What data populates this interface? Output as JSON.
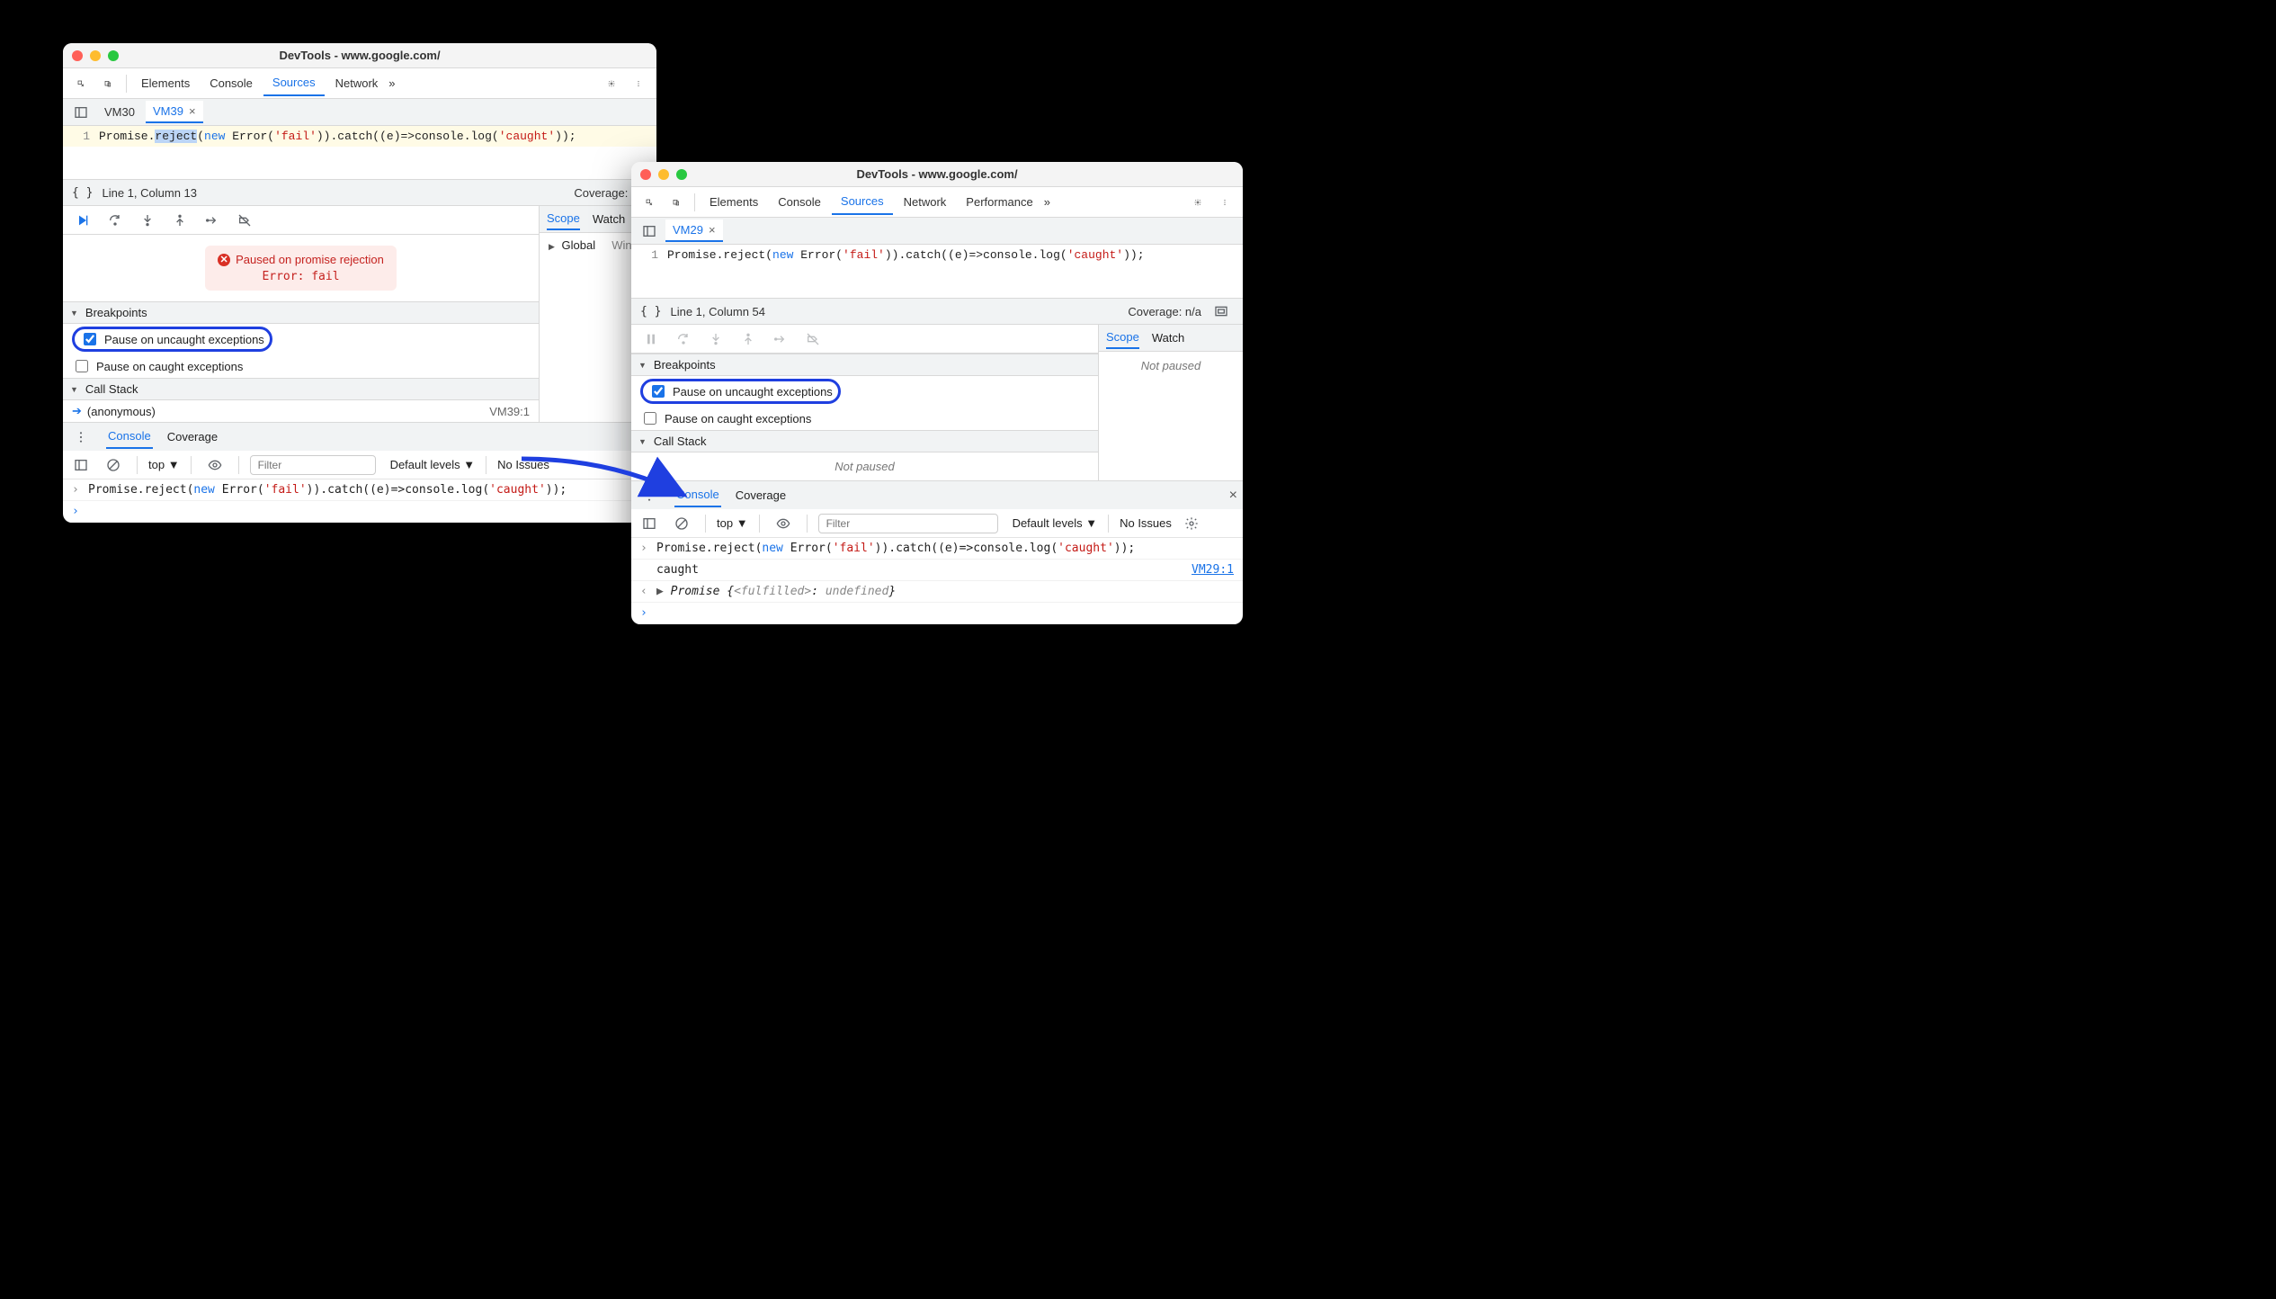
{
  "left": {
    "title": "DevTools - www.google.com/",
    "tabs": [
      "Elements",
      "Console",
      "Sources",
      "Network"
    ],
    "active_tab": "Sources",
    "overflow": "»",
    "files": {
      "inactive": "VM30",
      "active": "VM39"
    },
    "line_number": "1",
    "code": {
      "p1": "Promise.",
      "sel": "reject",
      "p2": "(",
      "kw_new": "new",
      "p3": " Error(",
      "str1": "'fail'",
      "p4": ")).catch((e)=>console.log(",
      "str2": "'caught'",
      "p5": "));"
    },
    "status_label": "{ }",
    "status_pos": "Line 1, Column 13",
    "coverage": "Coverage: n/a",
    "pause_msg": "Paused on promise rejection",
    "pause_err": "Error: fail",
    "scope_tab": "Scope",
    "watch_tab": "Watch",
    "scope_global": "Global",
    "scope_global_val": "Win",
    "bp_header": "Breakpoints",
    "bp_uncaught": "Pause on uncaught exceptions",
    "bp_caught": "Pause on caught exceptions",
    "cs_header": "Call Stack",
    "cs_item": "(anonymous)",
    "cs_loc": "VM39:1",
    "drawer_tabs": {
      "console": "Console",
      "coverage": "Coverage"
    },
    "console_bar": {
      "context": "top",
      "filter_placeholder": "Filter",
      "levels": "Default levels",
      "issues": "No Issues"
    },
    "console_line": {
      "p1": "Promise.reject(",
      "kw_new": "new",
      "p2": " Error(",
      "str1": "'fail'",
      "p3": ")).catch((e)=>console.log(",
      "str2": "'caught'",
      "p4": "));"
    }
  },
  "right": {
    "title": "DevTools - www.google.com/",
    "tabs": [
      "Elements",
      "Console",
      "Sources",
      "Network",
      "Performance"
    ],
    "active_tab": "Sources",
    "overflow": "»",
    "file_active": "VM29",
    "line_number": "1",
    "code": {
      "p1": "Promise.reject(",
      "kw_new": "new",
      "p2": " Error(",
      "str1": "'fail'",
      "p3": ")).catch((e)=>console.log(",
      "str2": "'caught'",
      "p4": "));"
    },
    "status_label": "{ }",
    "status_pos": "Line 1, Column 54",
    "coverage": "Coverage: n/a",
    "scope_tab": "Scope",
    "watch_tab": "Watch",
    "not_paused": "Not paused",
    "bp_header": "Breakpoints",
    "bp_uncaught": "Pause on uncaught exceptions",
    "bp_caught": "Pause on caught exceptions",
    "cs_header": "Call Stack",
    "cs_not_paused": "Not paused",
    "drawer_tabs": {
      "console": "Console",
      "coverage": "Coverage"
    },
    "console_bar": {
      "context": "top",
      "filter_placeholder": "Filter",
      "levels": "Default levels",
      "issues": "No Issues"
    },
    "console_lines": {
      "l1": {
        "p1": "Promise.reject(",
        "kw_new": "new",
        "p2": " Error(",
        "str1": "'fail'",
        "p3": ")).catch((e)=>console.log(",
        "str2": "'caught'",
        "p4": "));"
      },
      "l2_text": "caught",
      "l2_link": "VM29:1",
      "l3_prefix": "Promise ",
      "l3_open": "{",
      "l3_state": "<fulfilled>",
      "l3_sep": ": ",
      "l3_val": "undefined",
      "l3_close": "}"
    }
  }
}
